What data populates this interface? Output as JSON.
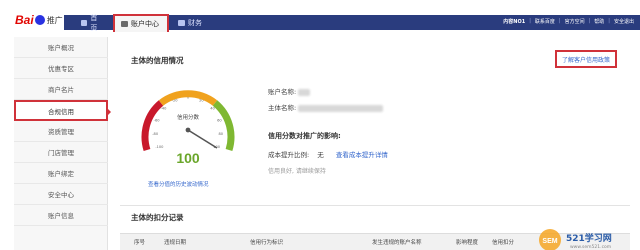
{
  "header": {
    "logo_text": "Bai",
    "brand": "推广",
    "tabs": [
      {
        "label": "首页",
        "icon": "home-icon"
      },
      {
        "label": "账户中心",
        "icon": "user-icon"
      },
      {
        "label": "财务",
        "icon": "wallet-icon"
      }
    ],
    "toplinks": [
      "内容NO1",
      "联系百度",
      "官方空间",
      "帮助",
      "安全退出"
    ]
  },
  "sidebar": {
    "items": [
      {
        "label": "账户概况"
      },
      {
        "label": "优惠专区"
      },
      {
        "label": "商户名片"
      },
      {
        "label": "合规信用"
      },
      {
        "label": "资质管理"
      },
      {
        "label": "门店管理"
      },
      {
        "label": "账户绑定"
      },
      {
        "label": "安全中心"
      },
      {
        "label": "账户信息"
      }
    ],
    "active_index": 3
  },
  "main": {
    "credit_title": "主体的信用情况",
    "credit_link": "了解客户信用政策",
    "gauge": {
      "label": "信用分数",
      "score": "100",
      "score_value": 100,
      "ticks": [
        "-100",
        "-90",
        "-80",
        "-70",
        "-60",
        "-50",
        "-40",
        "-30",
        "-20",
        "-10",
        "0",
        "10",
        "20",
        "30",
        "40",
        "50",
        "60",
        "70",
        "80",
        "90",
        "100"
      ],
      "caption": "查看分值的历史波动情况",
      "colors": {
        "red": "#c8192c",
        "orange": "#f0a21e",
        "green": "#7fb832",
        "score": "#6aa62a"
      }
    },
    "account_name_label": "账户名称:",
    "entity_name_label": "主体名称:",
    "impact_title": "信用分数对推广的影响:",
    "cost_label": "成本提升比例:",
    "cost_value": "无",
    "cost_link": "查看成本提升详情",
    "credit_good": "信用良好, 请继续保持",
    "deduction_title": "主体的扣分记录",
    "table_headers": [
      "序号",
      "违规日期",
      "信用行为标识",
      "发生违规的账户名称",
      "影响程度",
      "信用扣分"
    ]
  },
  "watermark": {
    "logo": "SEM",
    "text": "521学习网",
    "url": "www.sem521.com"
  }
}
